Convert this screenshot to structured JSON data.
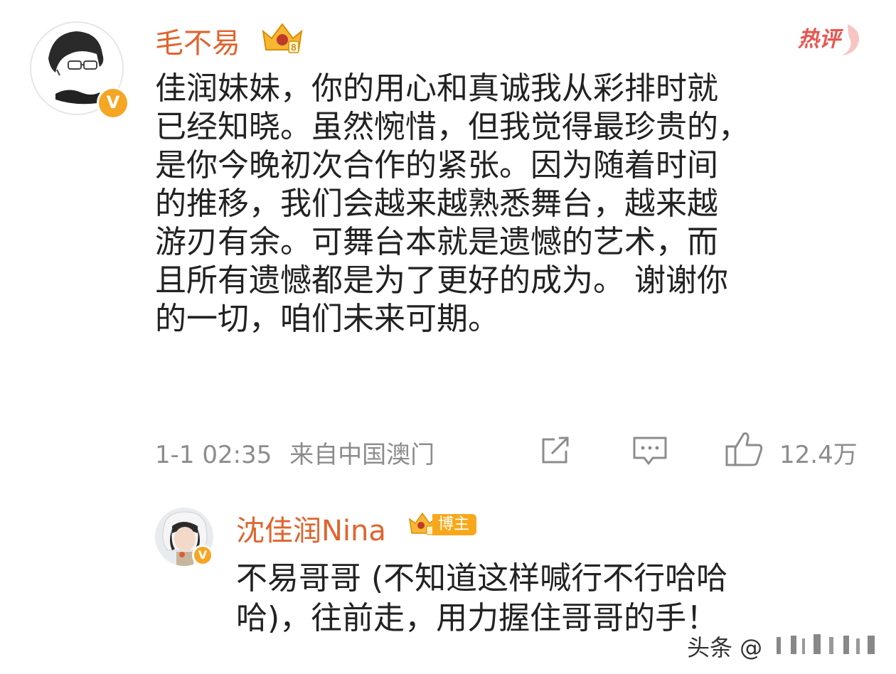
{
  "comment": {
    "username": "毛不易",
    "hot_label": "热评",
    "text_lines": [
      "佳润妹妹，你的用心和真诚我从彩排时就",
      "已经知晓。虽然惋惜，但我觉得最珍贵的，",
      "是你今晚初次合作的紧张。因为随着时间",
      "的推移，我们会越来越熟悉舞台，越来越",
      "游刃有余。可舞台本就是遗憾的艺术，而",
      "且所有遗憾都是为了更好的成为。 谢谢你",
      "的一切，咱们未来可期。"
    ],
    "timestamp": "1-1 02:35",
    "location": "来自中国澳门",
    "like_count": "12.4万",
    "verified_badge": "V"
  },
  "reply": {
    "username": "沈佳润Nina",
    "tag_label": "博主",
    "text_lines": [
      "不易哥哥 (不知道这样喊行不行哈哈",
      "哈)，往前走，用力握住哥哥的手！"
    ],
    "verified_badge": "V"
  },
  "watermark": {
    "text": "头条 @"
  },
  "colors": {
    "username": "#e0642d",
    "body_text": "#222222",
    "meta_text": "#8c8c8c",
    "badge_gold": "#f5a623",
    "hot_red": "#e8554f"
  },
  "icons": {
    "share": "share-icon",
    "comment": "comment-icon",
    "like": "thumbs-up-icon"
  }
}
